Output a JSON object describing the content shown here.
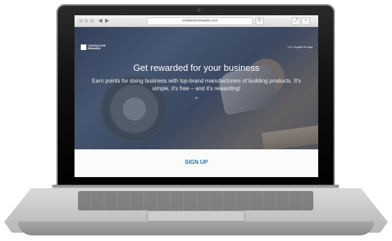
{
  "browser": {
    "url": "contractorrewards.com",
    "buttons": [
      "◀",
      "▶",
      "↻",
      "⤴",
      "+"
    ]
  },
  "header": {
    "logo_text": "CONTRACTOR REWARDS",
    "nav": "U.S. English  ▾  Login"
  },
  "hero": {
    "title": "Get rewarded for your business",
    "subtitle": "Earn points for doing business with top-brand manufacturers of building products. It's simple, it's free – and it's rewarding!",
    "chevron": "⌄"
  },
  "cta": {
    "signup_label": "SIGN UP"
  }
}
